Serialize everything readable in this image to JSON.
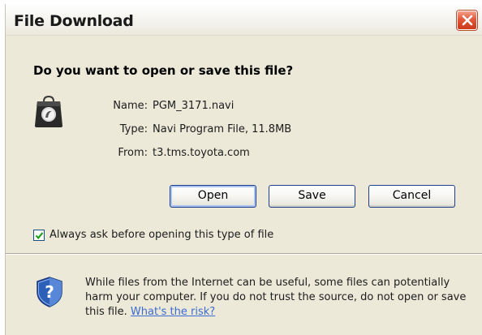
{
  "window": {
    "title": "File Download"
  },
  "dialog": {
    "question": "Do you want to open or save this file?",
    "file": {
      "name_label": "Name:",
      "name_value": "PGM_3171.navi",
      "type_label": "Type:",
      "type_value": "Navi Program File, 11.8MB",
      "from_label": "From:",
      "from_value": "t3.tms.toyota.com",
      "icon": "navi-file-icon"
    },
    "buttons": {
      "open": "Open",
      "save": "Save",
      "cancel": "Cancel"
    },
    "always_ask": {
      "label": "Always ask before opening this type of file",
      "checked": true
    },
    "warning": {
      "text": "While files from the Internet can be useful, some files can potentially harm your computer. If you do not trust the source, do not open or save this file. ",
      "link": "What's the risk?",
      "icon": "security-shield-icon"
    }
  },
  "colors": {
    "dialog_bg": "#ece9d8",
    "close_button": "#e3573a",
    "link": "#3b6bd0",
    "button_border": "#1f3f8c"
  }
}
